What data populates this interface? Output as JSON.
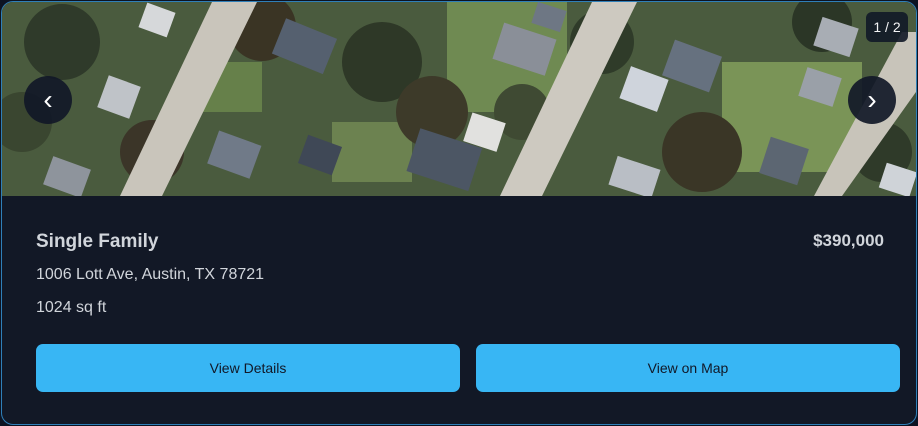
{
  "gallery": {
    "counter": "1 / 2",
    "prev_icon": "chevron-left-icon",
    "next_icon": "chevron-right-icon",
    "prev_glyph": "‹",
    "next_glyph": "›"
  },
  "listing": {
    "property_type": "Single Family",
    "price": "$390,000",
    "address": "1006 Lott Ave, Austin, TX 78721",
    "size": "1024 sq ft"
  },
  "actions": {
    "details_label": "View Details",
    "map_label": "View on Map"
  },
  "colors": {
    "background": "#121826",
    "accent": "#38b6f4",
    "border": "#2f7fb8",
    "text": "#d1d5db"
  }
}
